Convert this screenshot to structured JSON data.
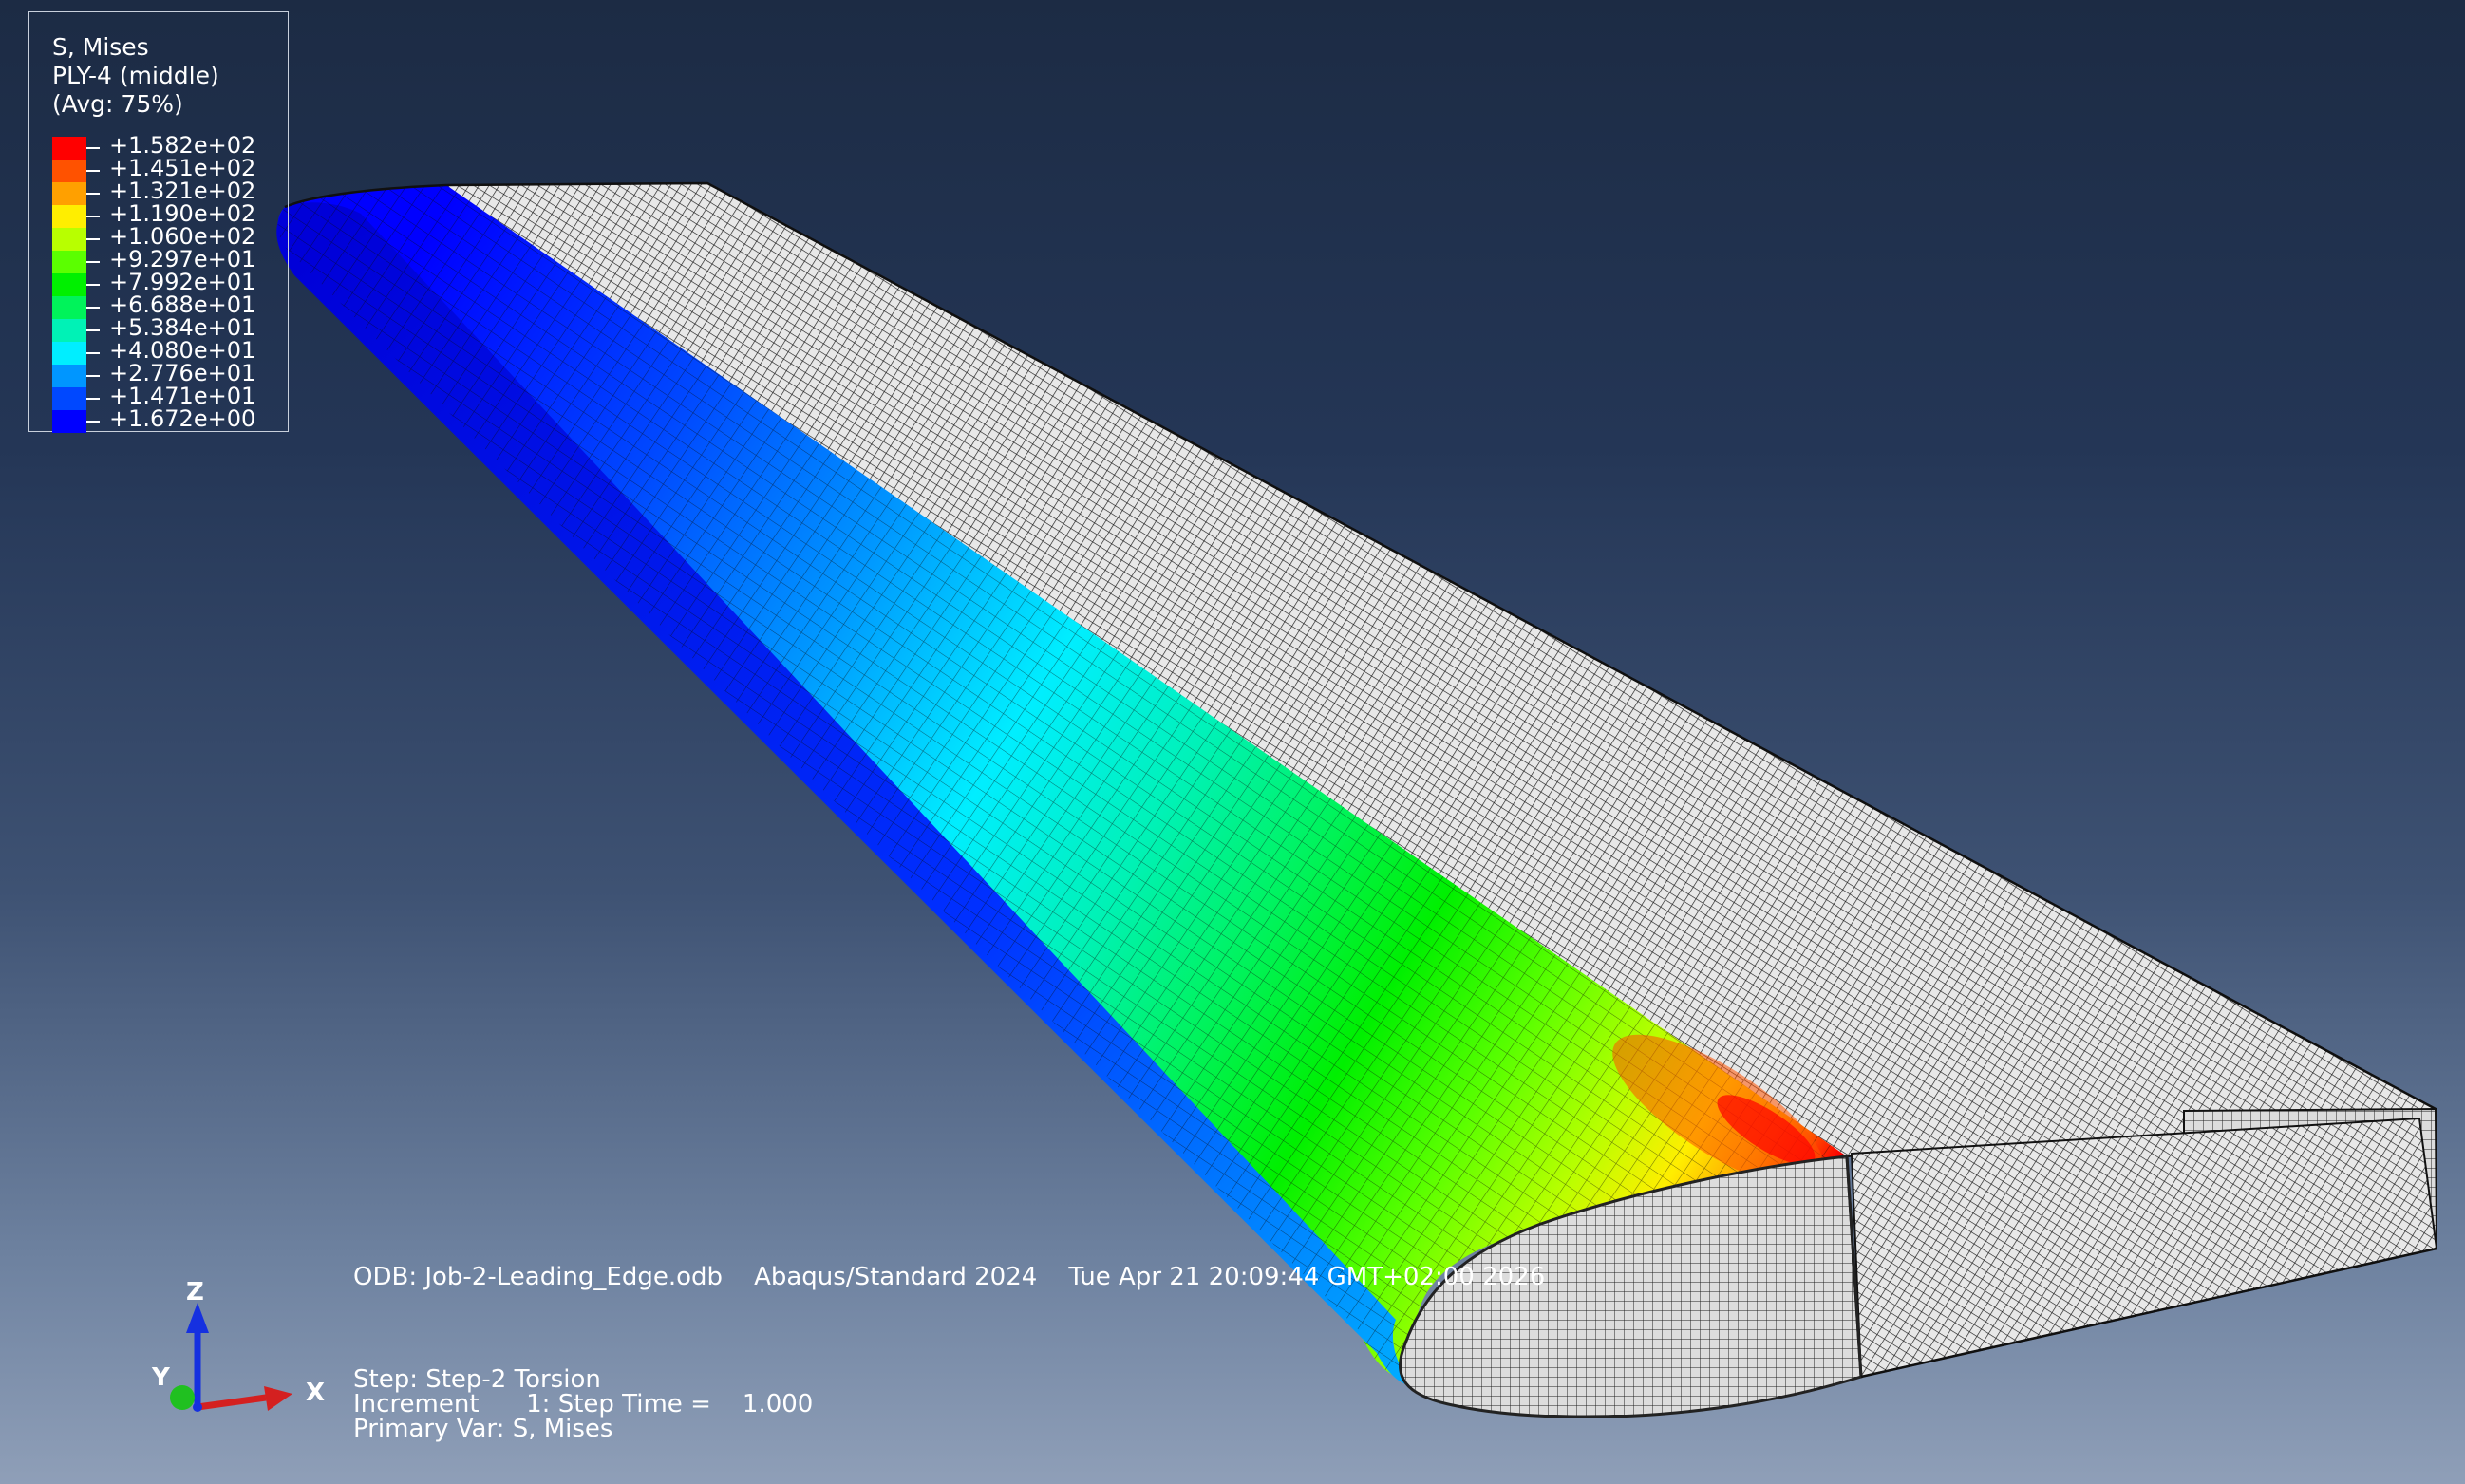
{
  "legend": {
    "title_lines": [
      "S, Mises",
      "PLY-4 (middle)",
      "(Avg: 75%)"
    ],
    "entries": [
      {
        "value": "+1.582e+02",
        "color": "#ff0000"
      },
      {
        "value": "+1.451e+02",
        "color": "#ff5200"
      },
      {
        "value": "+1.321e+02",
        "color": "#ffa000"
      },
      {
        "value": "+1.190e+02",
        "color": "#ffee00"
      },
      {
        "value": "+1.060e+02",
        "color": "#b8ff00"
      },
      {
        "value": "+9.297e+01",
        "color": "#5bff00"
      },
      {
        "value": "+7.992e+01",
        "color": "#00f000"
      },
      {
        "value": "+6.688e+01",
        "color": "#00f35a"
      },
      {
        "value": "+5.384e+01",
        "color": "#00f2b6"
      },
      {
        "value": "+4.080e+01",
        "color": "#00eeff"
      },
      {
        "value": "+2.776e+01",
        "color": "#0096ff"
      },
      {
        "value": "+1.471e+01",
        "color": "#0048ff"
      },
      {
        "value": "+1.672e+00",
        "color": "#0000ff"
      }
    ]
  },
  "info": {
    "odb_line": "ODB: Job-2-Leading_Edge.odb    Abaqus/Standard 2024    Tue Apr 21 20:09:44 GMT+02:00 2026",
    "step_line": "Step: Step-2 Torsion",
    "increment_line": "Increment      1: Step Time =    1.000",
    "primary_var_line": "Primary Var: S, Mises"
  },
  "triad": {
    "x_label": "X",
    "y_label": "Y",
    "z_label": "Z",
    "colors": {
      "x": "#d42020",
      "y": "#20c020",
      "z": "#1530e0"
    }
  },
  "model": {
    "wireframe_color": "#e6e6e6",
    "mesh_line_color": "#1a1a1a"
  }
}
